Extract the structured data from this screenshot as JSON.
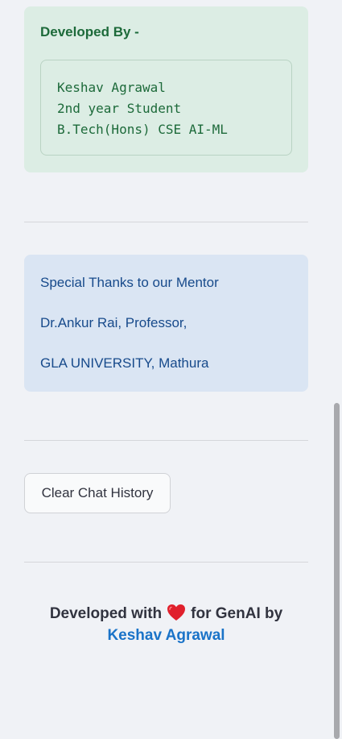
{
  "developer_box": {
    "title": "Developed By -",
    "lines": [
      "Keshav Agrawal",
      "2nd year Student",
      "B.Tech(Hons) CSE AI-ML"
    ]
  },
  "mentor_box": {
    "line1": "Special Thanks to our Mentor",
    "line2": "Dr.Ankur Rai, Professor,",
    "line3": "GLA UNIVERSITY, Mathura"
  },
  "buttons": {
    "clear_chat": "Clear Chat History"
  },
  "footer": {
    "prefix": "Developed with",
    "heart_icon": "heart-icon",
    "suffix": "for GenAI by",
    "author_link": "Keshav Agrawal"
  },
  "colors": {
    "accent": "#ff4b4b",
    "success_bg": "#dcede4",
    "success_text": "#1d6a3a",
    "info_bg": "#dae5f3",
    "info_text": "#174a8b",
    "link": "#1a73c8",
    "heart": "#e0202c"
  }
}
